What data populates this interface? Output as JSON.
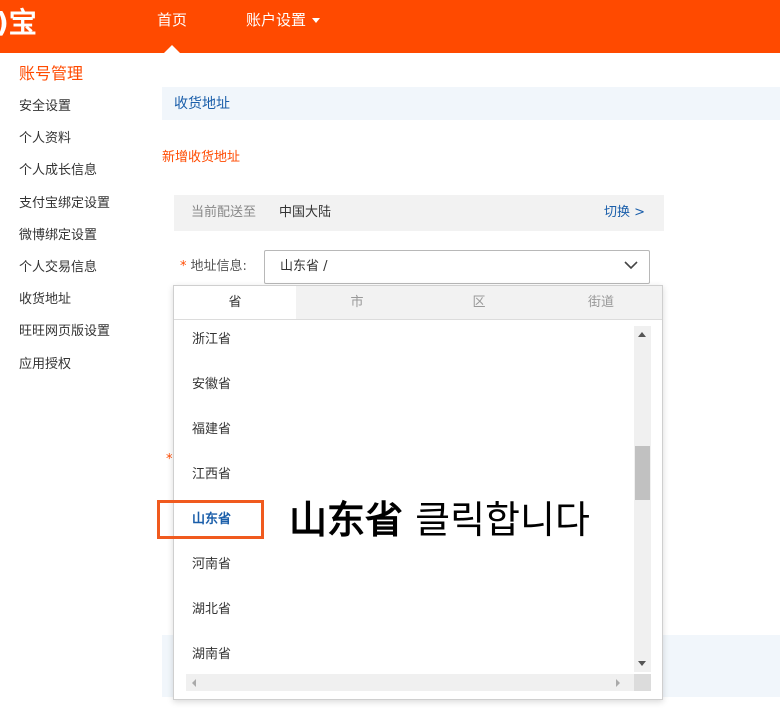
{
  "header": {
    "logo_text": "宝",
    "nav_home": "首页",
    "nav_account": "账户设置"
  },
  "sidebar": {
    "title": "账号管理",
    "items": [
      "安全设置",
      "个人资料",
      "个人成长信息",
      "支付宝绑定设置",
      "微博绑定设置",
      "个人交易信息",
      "收货地址",
      "旺旺网页版设置",
      "应用授权"
    ]
  },
  "main": {
    "section_title": "收货地址",
    "add_address": "新增收货地址",
    "delivery_label": "当前配送至",
    "delivery_value": "中国大陆",
    "switch_label": "切换 >",
    "address_field_label": "地址信息:",
    "address_required_mark": "*",
    "address_value": "山东省 /"
  },
  "dropdown": {
    "tabs": [
      "省",
      "市",
      "区",
      "街道"
    ],
    "active_tab": "省",
    "provinces": [
      "浙江省",
      "安徽省",
      "福建省",
      "江西省",
      "山东省",
      "河南省",
      "湖北省",
      "湖南省"
    ],
    "selected": "山东省"
  },
  "annotation": {
    "strong": "山东省",
    "text": "클릭합니다"
  },
  "colors": {
    "brand": "#ff4a00",
    "link": "#1a5eaa",
    "highlight": "#f05a1e"
  }
}
